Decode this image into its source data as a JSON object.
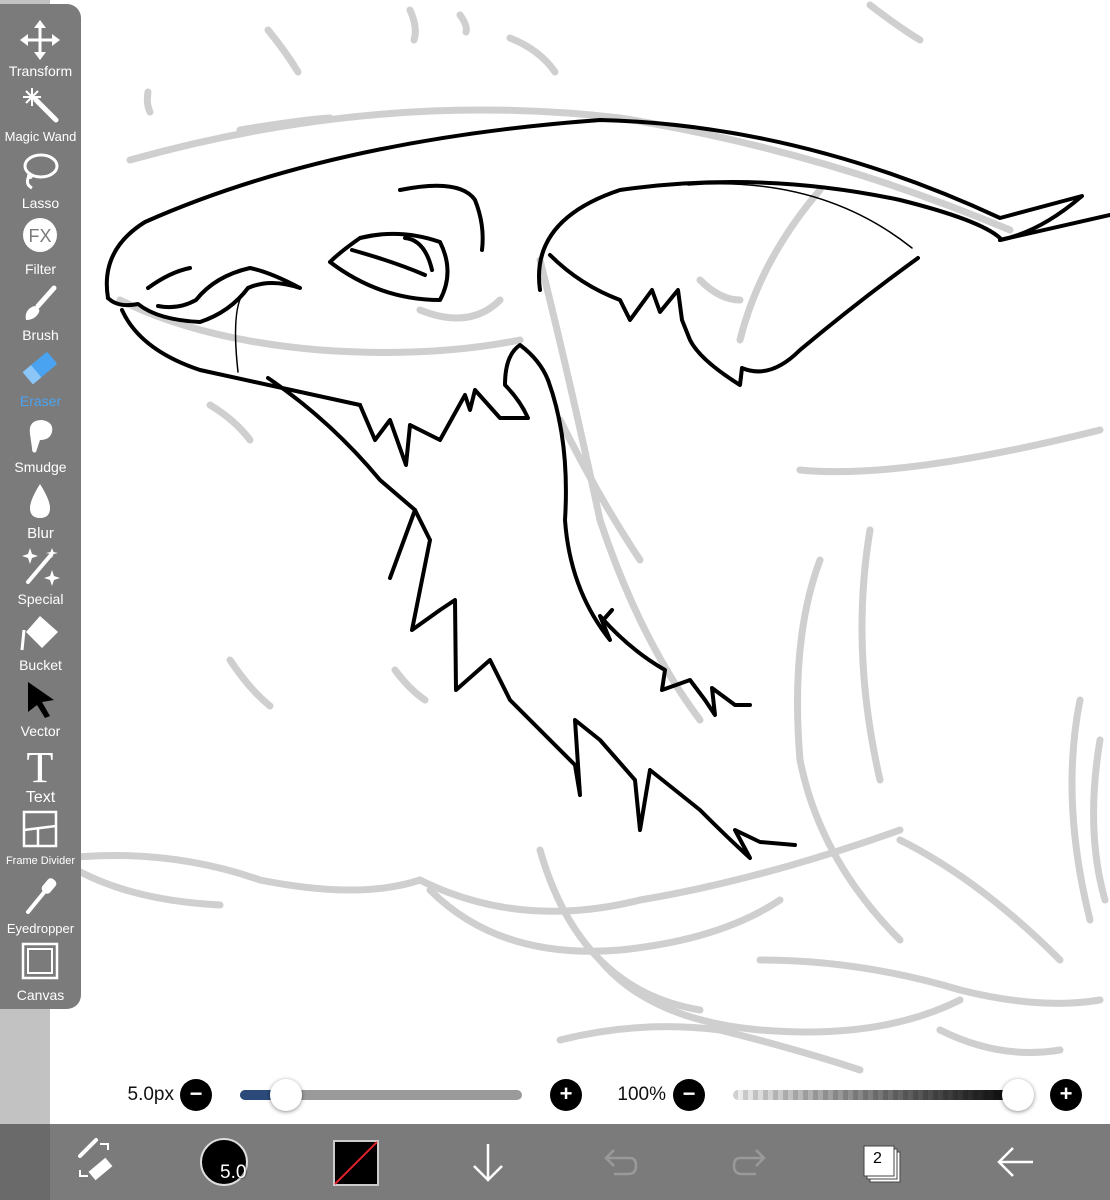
{
  "toolbar": {
    "tools": [
      {
        "label": "Transform",
        "icon": "transform-icon"
      },
      {
        "label": "Magic Wand",
        "icon": "magic-wand-icon"
      },
      {
        "label": "Lasso",
        "icon": "lasso-icon"
      },
      {
        "label": "Filter",
        "icon": "fx-filter-icon",
        "glyph": "FX"
      },
      {
        "label": "Brush",
        "icon": "brush-icon"
      },
      {
        "label": "Eraser",
        "icon": "eraser-icon",
        "active": true
      },
      {
        "label": "Smudge",
        "icon": "smudge-icon"
      },
      {
        "label": "Blur",
        "icon": "blur-drop-icon"
      },
      {
        "label": "Special",
        "icon": "special-sparkle-icon"
      },
      {
        "label": "Bucket",
        "icon": "bucket-icon"
      },
      {
        "label": "Vector",
        "icon": "vector-arrow-icon"
      },
      {
        "label": "Text",
        "icon": "text-icon",
        "glyph": "T"
      },
      {
        "label": "Frame Divider",
        "icon": "frame-divider-icon"
      },
      {
        "label": "Eyedropper",
        "icon": "eyedropper-icon"
      },
      {
        "label": "Canvas",
        "icon": "canvas-icon"
      }
    ],
    "active_color": "#4aa3f0",
    "background_color": "#7b7b7b"
  },
  "sliders": {
    "size": {
      "value_label": "5.0px",
      "minus": "−",
      "plus": "+",
      "fill_fraction": 0.15
    },
    "opacity": {
      "value_label": "100%",
      "minus": "−",
      "plus": "+",
      "fill_fraction": 1.0
    },
    "track_fill_color": "#2b4a7a"
  },
  "bottom_bar": {
    "swap_tools_icon": "swap-brush-eraser-icon",
    "brush_size_badge": "5.0",
    "color_swatch": "transparent-color-icon",
    "layer_count": "2",
    "icons": [
      "move-down-icon",
      "undo-icon",
      "redo-icon",
      "layers-icon",
      "back-arrow-icon"
    ]
  }
}
